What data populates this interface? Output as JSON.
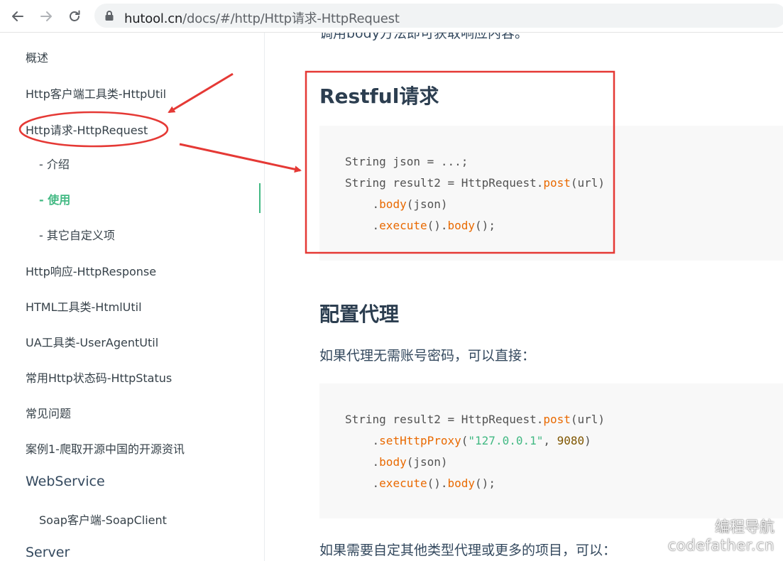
{
  "browser": {
    "url_host": "hutool.cn",
    "url_path": "/docs/#/http/Http请求-HttpRequest"
  },
  "sidebar": {
    "items": [
      {
        "label": "概述"
      },
      {
        "label": "Http客户端工具类-HttpUtil"
      },
      {
        "label": "Http请求-HttpRequest"
      },
      {
        "label": "- 介绍"
      },
      {
        "label": "- 使用"
      },
      {
        "label": "- 其它自定义项"
      },
      {
        "label": "Http响应-HttpResponse"
      },
      {
        "label": "HTML工具类-HtmlUtil"
      },
      {
        "label": "UA工具类-UserAgentUtil"
      },
      {
        "label": "常用Http状态码-HttpStatus"
      },
      {
        "label": "常见问题"
      },
      {
        "label": "案例1-爬取开源中国的开源资讯"
      },
      {
        "label": "WebService"
      },
      {
        "label": "Soap客户端-SoapClient"
      },
      {
        "label": "Server"
      }
    ]
  },
  "main": {
    "cut_text": "调用body方法即可获取响应内容。",
    "section1_title": "Restful请求",
    "code1": {
      "l1": "String json = ...;",
      "l2a": "String result2 = HttpRequest.",
      "l2b": "post",
      "l2c": "(url)",
      "l3a": "    .",
      "l3b": "body",
      "l3c": "(json)",
      "l4a": "    .",
      "l4b": "execute",
      "l4c": "().",
      "l4d": "body",
      "l4e": "();"
    },
    "section2_title": "配置代理",
    "para1": "如果代理无需账号密码，可以直接：",
    "code2": {
      "l1a": "String result2 = HttpRequest.",
      "l1b": "post",
      "l1c": "(url)",
      "l2a": "    .",
      "l2b": "setHttpProxy",
      "l2c": "(",
      "l2d": "\"127.0.0.1\"",
      "l2e": ", ",
      "l2f": "9080",
      "l2g": ")",
      "l3a": "    .",
      "l3b": "body",
      "l3c": "(json)",
      "l4a": "    .",
      "l4b": "execute",
      "l4c": "().",
      "l4d": "body",
      "l4e": "();"
    },
    "para2": "如果需要自定其他类型代理或更多的项目，可以："
  },
  "watermark": {
    "cn": "编程导航",
    "en": "codefather.cn"
  },
  "colors": {
    "accent_green": "#42b983",
    "annotation_red": "#e53935",
    "code_fn": "#e96900",
    "code_bg": "#f8f8f8"
  }
}
